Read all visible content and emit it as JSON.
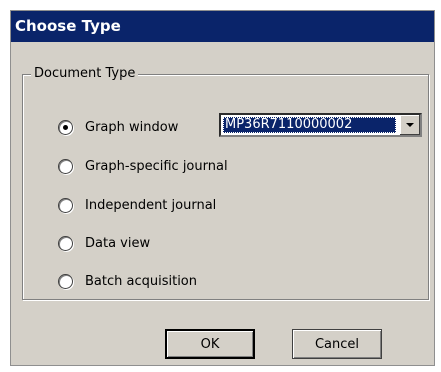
{
  "dialog": {
    "title": "Choose Type",
    "group_label": "Document Type",
    "options": [
      {
        "label": "Graph window",
        "checked": true
      },
      {
        "label": "Graph-specific journal",
        "checked": false
      },
      {
        "label": "Independent journal",
        "checked": false
      },
      {
        "label": "Data view",
        "checked": false
      },
      {
        "label": "Batch acquisition",
        "checked": false
      }
    ],
    "device_select": {
      "value": "MP36R7110000002",
      "icon": "chevron-down-icon"
    },
    "ok_label": "OK",
    "cancel_label": "Cancel"
  },
  "colors": {
    "titlebar": "#0a246a",
    "face": "#d4d0c8",
    "selection": "#0a246a"
  }
}
